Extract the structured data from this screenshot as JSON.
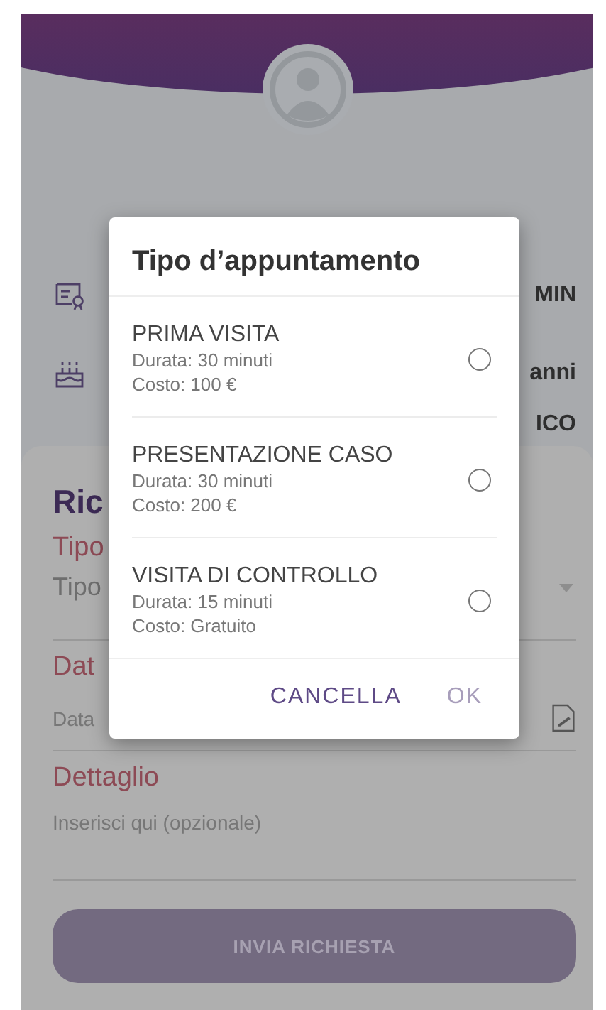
{
  "profile_rows": [
    {
      "kind": "certificate",
      "value": "MIN"
    },
    {
      "kind": "cake",
      "value": "anni"
    },
    {
      "kind": "none",
      "value": "ICO"
    }
  ],
  "request_sheet": {
    "title": "Ric",
    "type_label": "Tipo",
    "type_placeholder": "Tipo",
    "date_label": "Dat",
    "date_placeholder": "Data",
    "detail_label": "Dettaglio",
    "detail_placeholder": "Inserisci qui (opzionale)",
    "submit_button": "INVIA RICHIESTA"
  },
  "dialog": {
    "title": "Tipo d’appuntamento",
    "options": [
      {
        "name": "PRIMA VISITA",
        "duration": "Durata: 30 minuti",
        "cost": "Costo: 100 €",
        "selected": false
      },
      {
        "name": "PRESENTAZIONE CASO",
        "duration": "Durata: 30 minuti",
        "cost": "Costo: 200 €",
        "selected": false
      },
      {
        "name": "VISITA DI CONTROLLO",
        "duration": "Durata: 15 minuti",
        "cost": "Costo: Gratuito",
        "selected": false
      }
    ],
    "buttons": [
      "CANCELLA",
      "OK"
    ]
  }
}
